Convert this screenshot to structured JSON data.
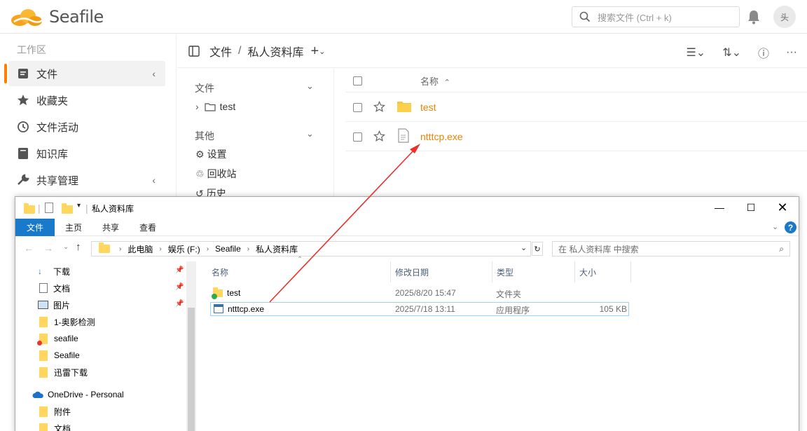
{
  "seafile": {
    "logo_text": "Seafile",
    "search_placeholder": "搜索文件 (Ctrl + k)",
    "avatar_alt": "头",
    "sidebar": {
      "section_title": "工作区",
      "items": [
        {
          "label": "文件",
          "icon": "file-icon",
          "active": true
        },
        {
          "label": "收藏夹",
          "icon": "star-icon"
        },
        {
          "label": "文件活动",
          "icon": "history-icon"
        },
        {
          "label": "知识库",
          "icon": "book-icon"
        },
        {
          "label": "共享管理",
          "icon": "wrench-icon"
        }
      ]
    },
    "path": {
      "root": "文件",
      "separator": "/",
      "current": "私人资料库"
    },
    "tree": {
      "files_header": "文件",
      "folder": "test",
      "other_header": "其他",
      "settings": "设置",
      "trash": "回收站",
      "history": "历史"
    },
    "list": {
      "name_header": "名称",
      "rows": [
        {
          "name": "test",
          "type": "folder"
        },
        {
          "name": "ntttcp.exe",
          "type": "file"
        }
      ]
    }
  },
  "explorer": {
    "title": "私人资料库",
    "ribbon_tabs": [
      "文件",
      "主页",
      "共享",
      "查看"
    ],
    "address": [
      "此电脑",
      "娱乐 (F:)",
      "Seafile",
      "私人资料库"
    ],
    "search_placeholder": "在 私人资料库 中搜索",
    "nav": [
      {
        "label": "下载",
        "icon": "download-icon",
        "pinned": true
      },
      {
        "label": "文档",
        "icon": "document-icon",
        "pinned": true
      },
      {
        "label": "图片",
        "icon": "picture-icon",
        "pinned": true
      },
      {
        "label": "1-奥影检测",
        "icon": "folder-icon"
      },
      {
        "label": "seafile",
        "icon": "folder-error-icon"
      },
      {
        "label": "Seafile",
        "icon": "folder-icon"
      },
      {
        "label": "迅雷下载",
        "icon": "folder-icon"
      },
      {
        "label": "OneDrive - Personal",
        "icon": "cloud-icon"
      },
      {
        "label": "附件",
        "icon": "folder-icon"
      },
      {
        "label": "文档",
        "icon": "folder-icon"
      }
    ],
    "columns": [
      "名称",
      "修改日期",
      "类型",
      "大小"
    ],
    "rows": [
      {
        "name": "test",
        "date": "2025/8/20 15:47",
        "type": "文件夹",
        "size": ""
      },
      {
        "name": "ntttcp.exe",
        "date": "2025/7/18 13:11",
        "type": "应用程序",
        "size": "105 KB"
      }
    ]
  },
  "colors": {
    "accent_orange": "#eb8205",
    "ribbon_blue": "#1979ca",
    "arrow_red": "#e8322a"
  }
}
